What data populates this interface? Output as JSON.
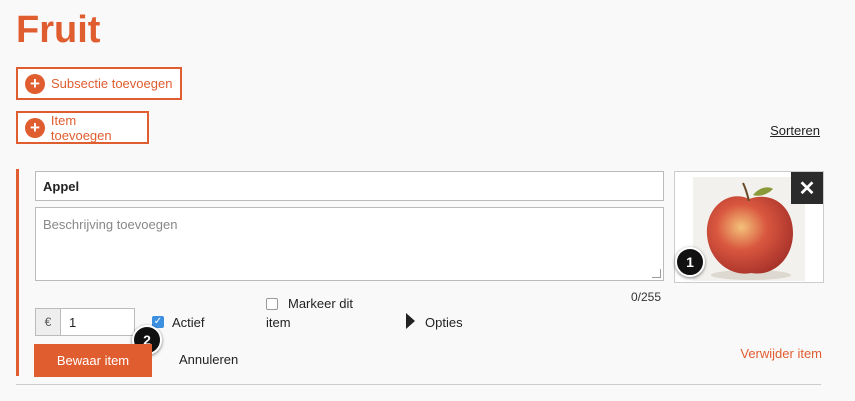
{
  "page": {
    "title": "Fruit"
  },
  "actions": {
    "add_subsection": "Subsectie toevoegen",
    "add_item": "Item toevoegen",
    "sort": "Sorteren"
  },
  "item": {
    "name": "Appel",
    "description_placeholder": "Beschrijving toevoegen",
    "char_count": "0/255",
    "currency": "€",
    "price": "1",
    "active_label": "Actief",
    "active_checked": true,
    "highlight_label_line1": "Markeer dit",
    "highlight_label_line2": "item",
    "highlight_checked": false,
    "options_label": "Opties",
    "save_label": "Bewaar item",
    "cancel_label": "Annuleren",
    "delete_label": "Verwijder item",
    "remove_image_glyph": "✕"
  },
  "callouts": [
    "1",
    "2"
  ],
  "colors": {
    "accent": "#e05d2f",
    "checkbox": "#3d8fe0"
  }
}
